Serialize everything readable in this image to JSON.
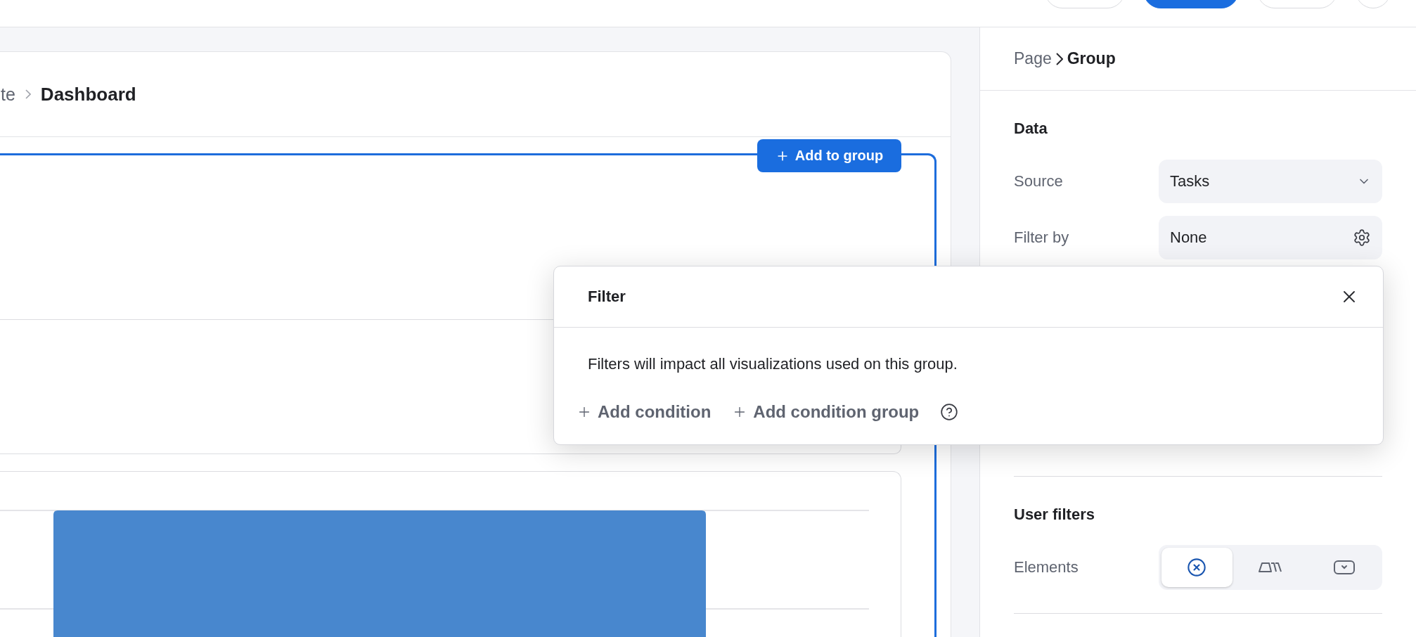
{
  "toolbar": {
    "buttons": [
      {
        "kind": "plain"
      },
      {
        "kind": "primary"
      },
      {
        "kind": "plain"
      },
      {
        "kind": "round"
      }
    ]
  },
  "canvas": {
    "breadcrumb": [
      "te",
      "Dashboard"
    ],
    "add_button": "Add to group"
  },
  "panel": {
    "breadcrumb": [
      "Page",
      "Group"
    ],
    "data_section": {
      "title": "Data",
      "fields": [
        {
          "label": "Source",
          "value": "Tasks",
          "kind": "select"
        },
        {
          "label": "Filter by",
          "value": "None",
          "kind": "settings"
        }
      ]
    },
    "user_filters": {
      "title": "User filters",
      "label": "Elements",
      "options": [
        {
          "kind": "clear",
          "selected": true
        },
        {
          "kind": "tabs",
          "selected": false
        },
        {
          "kind": "dropdown",
          "selected": false
        }
      ]
    }
  },
  "filter_popup": {
    "title": "Filter",
    "description": "Filters will impact all visualizations used on this group.",
    "actions": [
      "Add condition",
      "Add condition group"
    ]
  }
}
